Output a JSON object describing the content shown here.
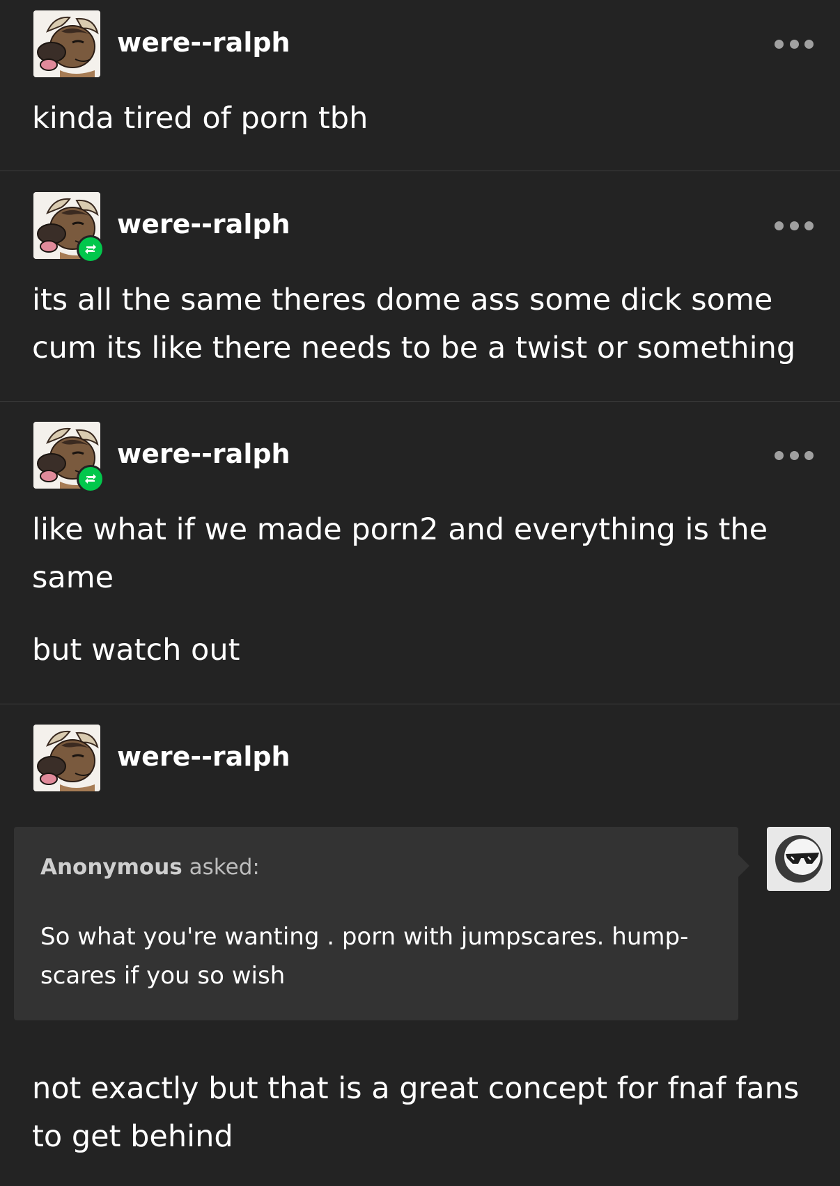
{
  "posts": [
    {
      "username": "were--ralph",
      "reblogged": false,
      "show_more": true,
      "paragraphs": [
        "kinda tired of porn tbh"
      ]
    },
    {
      "username": "were--ralph",
      "reblogged": true,
      "show_more": true,
      "paragraphs": [
        "its all the same theres dome ass some dick some cum its like there needs to be a twist or something"
      ]
    },
    {
      "username": "were--ralph",
      "reblogged": true,
      "show_more": true,
      "paragraphs": [
        "like what if we made porn2 and everything is the same",
        "but watch out"
      ]
    },
    {
      "username": "were--ralph",
      "reblogged": false,
      "show_more": false,
      "ask": {
        "asker": "Anonymous",
        "asked_label": "asked:",
        "question": "So what you're wanting . porn with jumpscares. hump-scares if you so wish"
      },
      "paragraphs": [
        "not exactly but that is a great concept for fnaf fans to get behind"
      ]
    }
  ],
  "colors": {
    "background": "#232323",
    "text": "#ffffff",
    "reblog_badge": "#02c74c",
    "ask_box": "#333333",
    "divider": "#3d3d3d"
  },
  "icons": {
    "avatar": "horned-animal-avatar-icon",
    "reblog": "reblog-icon",
    "more": "ellipsis-icon",
    "anon": "sunglasses-anon-icon"
  }
}
